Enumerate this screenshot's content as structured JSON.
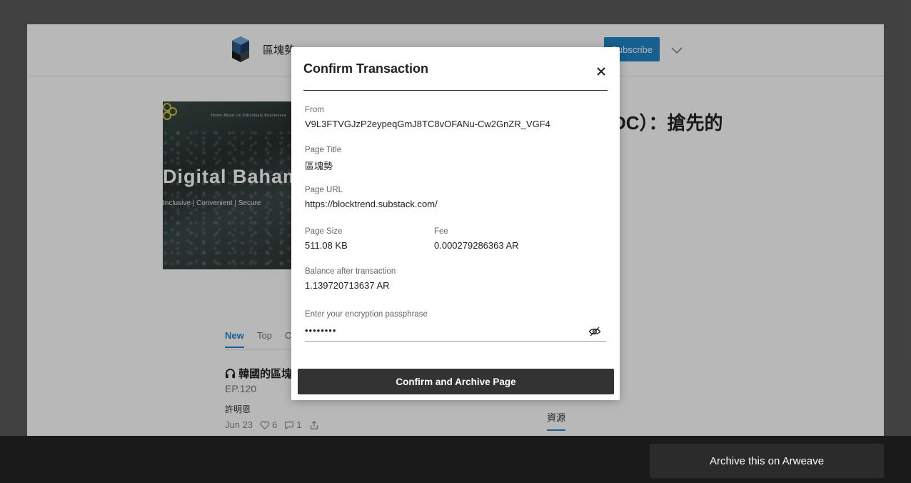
{
  "background": {
    "site_name": "區塊勢",
    "subscribe_label": "Subscribe",
    "hero": {
      "nav": "Home    About Us    Individuals    Businesses",
      "title": "Digital Bahamian",
      "subtitle": "Inclusive | Convenient | Secure"
    },
    "article_title_fragment": "DC）：搶先的",
    "tabs": [
      {
        "label": "New"
      },
      {
        "label": "Top"
      },
      {
        "label": "C"
      }
    ],
    "post": {
      "title": "韓國的區塊",
      "subtitle": "EP.120",
      "author": "許明恩",
      "date": "Jun 23",
      "likes": "6",
      "comments": "1"
    },
    "resource_tab": "資源"
  },
  "modal": {
    "title": "Confirm Transaction",
    "from_label": "From",
    "from_value": "V9L3FTVGJzP2eypeqGmJ8TC8vOFANu-Cw2GnZR_VGF4",
    "page_title_label": "Page Title",
    "page_title_value": "區塊勢",
    "page_url_label": "Page URL",
    "page_url_value": "https://blocktrend.substack.com/",
    "page_size_label": "Page Size",
    "page_size_value": "511.08 KB",
    "fee_label": "Fee",
    "fee_value": "0.000279286363 AR",
    "balance_label": "Balance after transaction",
    "balance_value": "1.139720713637 AR",
    "passphrase_label": "Enter your encryption passphrase",
    "passphrase_value": "••••••••",
    "confirm_label": "Confirm and Archive Page"
  },
  "bottom_bar": {
    "archive_label": "Archive this on Arweave"
  },
  "colors": {
    "accent": "#1f84c7",
    "dark_button": "#333333",
    "bottom_bar": "#1a1a1a"
  }
}
